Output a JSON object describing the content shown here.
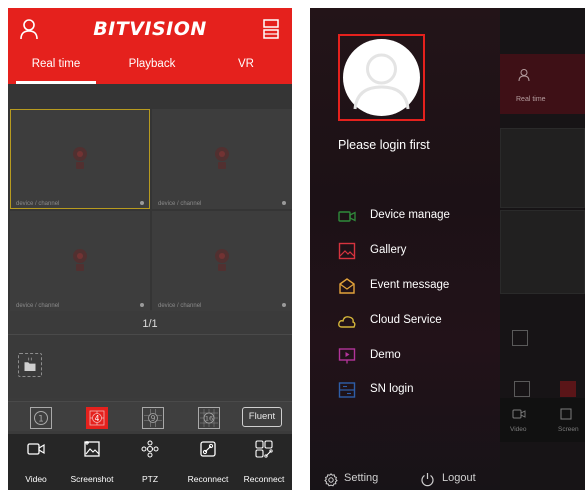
{
  "left_screen": {
    "app_title": "BITVISION",
    "tabs": [
      {
        "label": "Real time",
        "active": true
      },
      {
        "label": "Playback",
        "active": false
      },
      {
        "label": "VR",
        "active": false
      }
    ],
    "channel_cells": [
      {
        "label": "device / channel",
        "selected": true
      },
      {
        "label": "device / channel",
        "selected": false
      },
      {
        "label": "device / channel",
        "selected": false
      },
      {
        "label": "device / channel",
        "selected": false
      }
    ],
    "page_indicator": "1/1",
    "layout_buttons": [
      {
        "label": "1",
        "active": false
      },
      {
        "label": "4",
        "active": true
      },
      {
        "label": "9",
        "active": false
      },
      {
        "label": "16",
        "active": false
      }
    ],
    "stream_quality": "Fluent",
    "bottom_actions": [
      {
        "label": "Video",
        "icon": "video-icon"
      },
      {
        "label": "Screenshot",
        "icon": "screenshot-icon"
      },
      {
        "label": "PTZ",
        "icon": "ptz-icon"
      },
      {
        "label": "Reconnect",
        "icon": "reconnect-icon"
      },
      {
        "label": "Reconnect",
        "icon": "reconnect-all-icon"
      }
    ],
    "colors": {
      "brand_red": "#e5211d",
      "background": "#3b3b3b",
      "selected_border": "#b89b1f"
    }
  },
  "right_screen": {
    "drawer": {
      "login_prompt": "Please login first",
      "menu": [
        {
          "label": "Device manage",
          "icon": "device-manage-icon",
          "color": "#2f8a3a"
        },
        {
          "label": "Gallery",
          "icon": "gallery-icon",
          "color": "#d6333f"
        },
        {
          "label": "Event message",
          "icon": "event-message-icon",
          "color": "#e2a23a"
        },
        {
          "label": "Cloud Service",
          "icon": "cloud-service-icon",
          "color": "#d4b53a"
        },
        {
          "label": "Demo",
          "icon": "demo-icon",
          "color": "#b2349a"
        },
        {
          "label": "SN login",
          "icon": "sn-login-icon",
          "color": "#2e5ea8"
        }
      ],
      "footer": {
        "setting_label": "Setting",
        "logout_label": "Logout"
      }
    },
    "background_peek": {
      "tab_label": "Real time",
      "bottom_labels": [
        "Video",
        "Screen"
      ]
    }
  }
}
